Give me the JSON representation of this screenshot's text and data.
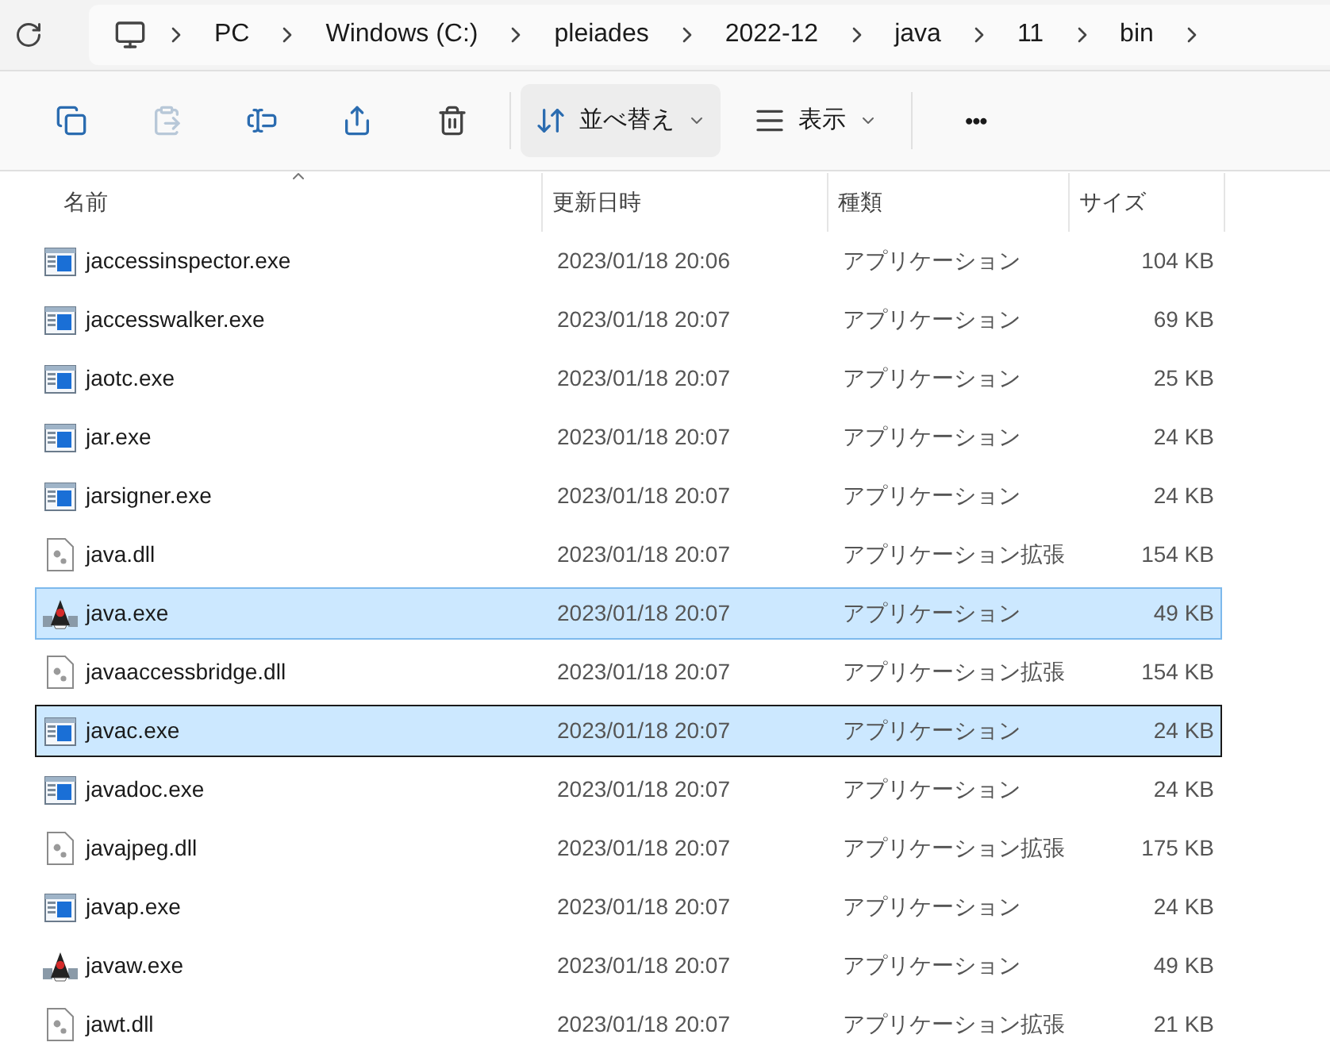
{
  "breadcrumb": [
    "PC",
    "Windows (C:)",
    "pleiades",
    "2022-12",
    "java",
    "11",
    "bin"
  ],
  "toolbar": [
    {
      "kind": "copy",
      "disabled": false
    },
    {
      "kind": "paste",
      "disabled": true
    },
    {
      "kind": "rename",
      "disabled": false
    },
    {
      "kind": "share",
      "disabled": false
    },
    {
      "kind": "delete",
      "disabled": false
    }
  ],
  "sort_button": {
    "label": "並べ替え"
  },
  "view_button": {
    "label": "表示"
  },
  "more_button": {
    "label": "•••"
  },
  "columns": [
    {
      "label": "名前",
      "sorted": true
    },
    {
      "label": "更新日時",
      "sorted": false
    },
    {
      "label": "種類",
      "sorted": false
    },
    {
      "label": "サイズ",
      "sorted": false
    }
  ],
  "rows": [
    {
      "kind": "exe",
      "name": "jaccessinspector.exe",
      "modified": "2023/01/18 20:06",
      "type": "アプリケーション",
      "size": "104 KB",
      "selected": false,
      "focused": false
    },
    {
      "kind": "exe",
      "name": "jaccesswalker.exe",
      "modified": "2023/01/18 20:07",
      "type": "アプリケーション",
      "size": "69 KB",
      "selected": false,
      "focused": false
    },
    {
      "kind": "exe",
      "name": "jaotc.exe",
      "modified": "2023/01/18 20:07",
      "type": "アプリケーション",
      "size": "25 KB",
      "selected": false,
      "focused": false
    },
    {
      "kind": "exe",
      "name": "jar.exe",
      "modified": "2023/01/18 20:07",
      "type": "アプリケーション",
      "size": "24 KB",
      "selected": false,
      "focused": false
    },
    {
      "kind": "exe",
      "name": "jarsigner.exe",
      "modified": "2023/01/18 20:07",
      "type": "アプリケーション",
      "size": "24 KB",
      "selected": false,
      "focused": false
    },
    {
      "kind": "dll",
      "name": "java.dll",
      "modified": "2023/01/18 20:07",
      "type": "アプリケーション拡張",
      "size": "154 KB",
      "selected": false,
      "focused": false
    },
    {
      "kind": "java",
      "name": "java.exe",
      "modified": "2023/01/18 20:07",
      "type": "アプリケーション",
      "size": "49 KB",
      "selected": true,
      "focused": false
    },
    {
      "kind": "dll",
      "name": "javaaccessbridge.dll",
      "modified": "2023/01/18 20:07",
      "type": "アプリケーション拡張",
      "size": "154 KB",
      "selected": false,
      "focused": false
    },
    {
      "kind": "exe",
      "name": "javac.exe",
      "modified": "2023/01/18 20:07",
      "type": "アプリケーション",
      "size": "24 KB",
      "selected": true,
      "focused": true
    },
    {
      "kind": "exe",
      "name": "javadoc.exe",
      "modified": "2023/01/18 20:07",
      "type": "アプリケーション",
      "size": "24 KB",
      "selected": false,
      "focused": false
    },
    {
      "kind": "dll",
      "name": "javajpeg.dll",
      "modified": "2023/01/18 20:07",
      "type": "アプリケーション拡張",
      "size": "175 KB",
      "selected": false,
      "focused": false
    },
    {
      "kind": "exe",
      "name": "javap.exe",
      "modified": "2023/01/18 20:07",
      "type": "アプリケーション",
      "size": "24 KB",
      "selected": false,
      "focused": false
    },
    {
      "kind": "java",
      "name": "javaw.exe",
      "modified": "2023/01/18 20:07",
      "type": "アプリケーション",
      "size": "49 KB",
      "selected": false,
      "focused": false
    },
    {
      "kind": "dll",
      "name": "jawt.dll",
      "modified": "2023/01/18 20:07",
      "type": "アプリケーション拡張",
      "size": "21 KB",
      "selected": false,
      "focused": false
    }
  ]
}
